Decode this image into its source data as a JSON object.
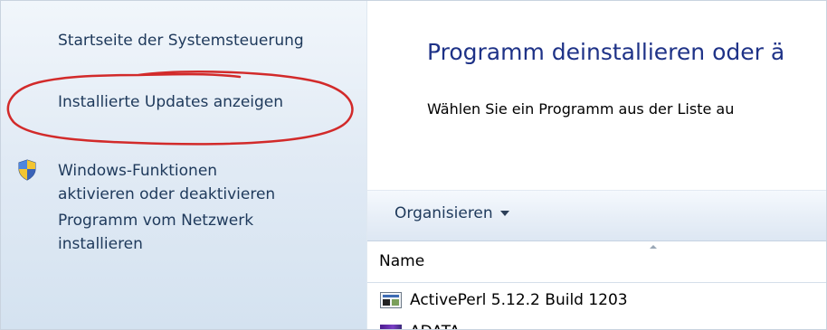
{
  "sidebar": {
    "items": [
      {
        "label": "Startseite der Systemsteuerung"
      },
      {
        "label": "Installierte Updates anzeigen"
      },
      {
        "label_line1": "Windows-Funktionen",
        "label_line2": "aktivieren oder deaktivieren",
        "icon": "uac-shield-icon"
      },
      {
        "label_line1": "Programm vom Netzwerk",
        "label_line2": "installieren"
      }
    ],
    "annotation_color": "#d22a2a"
  },
  "main": {
    "title": "Programm deinstallieren oder ä",
    "description": "Wählen Sie ein Programm aus der Liste au",
    "toolbar": {
      "organize_label": "Organisieren"
    },
    "columns": [
      {
        "label": "Name"
      }
    ],
    "programs": [
      {
        "name": "ActivePerl 5.12.2 Build 1203",
        "icon": "program-icon"
      },
      {
        "name": "ADATA",
        "icon": "program-icon"
      }
    ]
  },
  "colors": {
    "link": "#1e395b",
    "title": "#1e3287",
    "sidebar_bg": "#e2ebf5"
  }
}
